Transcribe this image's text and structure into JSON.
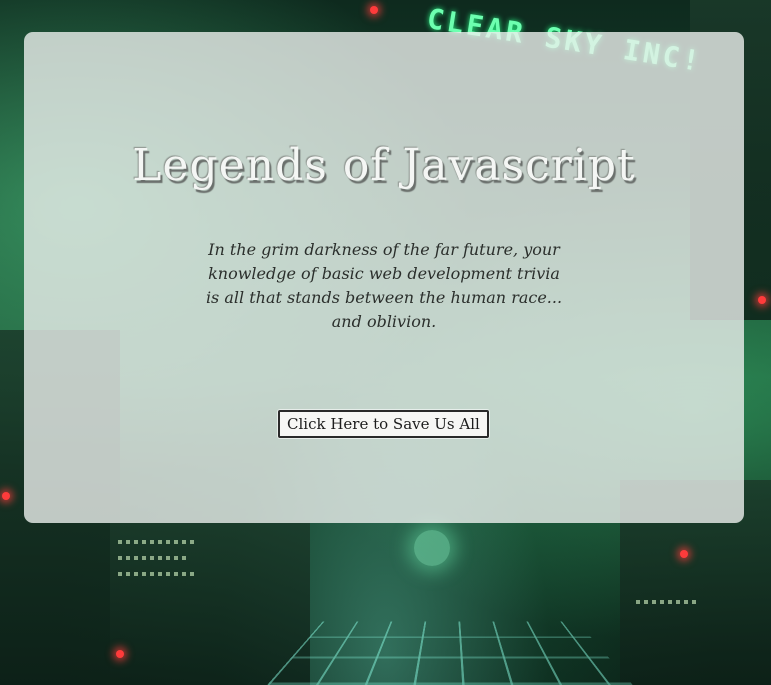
{
  "background": {
    "sign_text": "CLEAR SKY INC!"
  },
  "panel": {
    "title": "Legends of Javascript",
    "intro": "In the grim darkness of the far future, your knowledge of basic web development trivia is all that stands between the human race... and oblivion.",
    "start_button_label": "Click Here to Save Us All"
  },
  "colors": {
    "panel_background": "#ecf0ed",
    "title_text": "#f4f6f4",
    "body_text": "#2b2f2c",
    "background_accent": "#6dffb0"
  }
}
